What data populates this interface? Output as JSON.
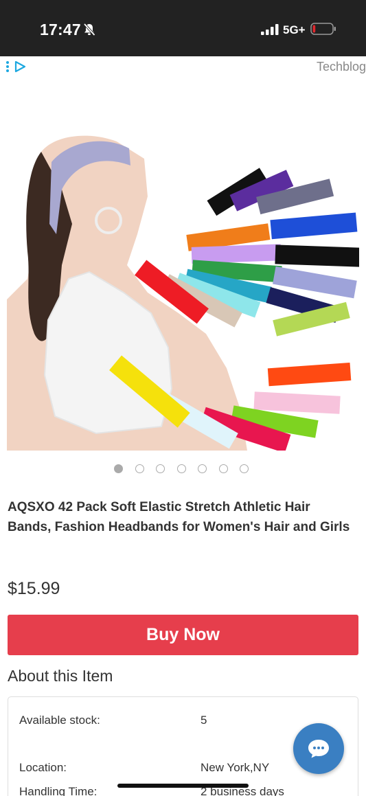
{
  "status_bar": {
    "time": "17:47",
    "network": "5G+",
    "icons": [
      "bell-off-icon",
      "signal-icon",
      "battery-icon"
    ],
    "battery_level": 0.1,
    "battery_color": "#e0282e"
  },
  "ad_bar": {
    "source": "Techblog",
    "icon": "ad-choices-icon",
    "icon_color": "#1ca8e0"
  },
  "product": {
    "image_icon": "headbands-product-image",
    "carousel_total": 7,
    "carousel_active": 1,
    "title": "AQSXO 42 Pack Soft Elastic Stretch Athletic Hair Bands, Fashion Headbands for Women's Hair and Girls",
    "price": "$15.99",
    "buy_label": "Buy Now",
    "buy_color": "#e63e4c"
  },
  "about": {
    "heading": "About this Item",
    "rows": [
      {
        "label": "Available stock:",
        "value": "5"
      },
      {
        "label": "Location:",
        "value": "New York,NY"
      },
      {
        "label": "Handling Time:",
        "value": "2 business days"
      }
    ]
  },
  "chat": {
    "icon": "chat-bubble-icon",
    "color": "#3a7fc2"
  }
}
